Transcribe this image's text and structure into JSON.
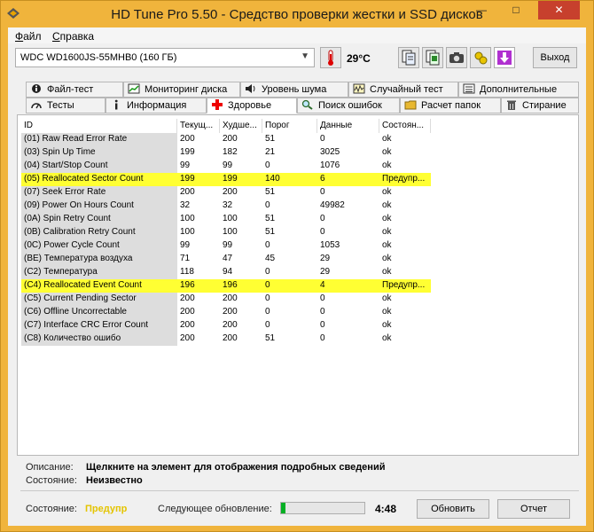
{
  "window": {
    "title": "HD Tune Pro 5.50 - Средство проверки жестки и SSD дисков",
    "controls": {
      "minimize": "—",
      "maximize": "□",
      "close": "✕"
    }
  },
  "menu": [
    {
      "first": "Ф",
      "rest": "айл"
    },
    {
      "first": "С",
      "rest": "правка"
    }
  ],
  "toolbar": {
    "drive": "WDC WD1600JS-55MHB0 (160 ГБ)",
    "temperature": "29°C",
    "exit_label": "Выход"
  },
  "tabs_top": [
    "Файл-тест",
    "Мониторинг диска",
    "Уровень шума",
    "Случайный тест",
    "Дополнительные тесты"
  ],
  "tabs_bottom": [
    "Тесты",
    "Информация",
    "Здоровье",
    "Поиск ошибок",
    "Расчет папок",
    "Стирание"
  ],
  "active_tab": "Здоровье",
  "table": {
    "headers": [
      "ID",
      "Текущ...",
      "Худше...",
      "Порог",
      "Данные",
      "Состоян..."
    ],
    "rows": [
      {
        "id": "(01) Raw Read Error Rate",
        "cur": "200",
        "worst": "200",
        "thr": "51",
        "data": "0",
        "status": "ok",
        "warn": false
      },
      {
        "id": "(03) Spin Up Time",
        "cur": "199",
        "worst": "182",
        "thr": "21",
        "data": "3025",
        "status": "ok",
        "warn": false
      },
      {
        "id": "(04) Start/Stop Count",
        "cur": "99",
        "worst": "99",
        "thr": "0",
        "data": "1076",
        "status": "ok",
        "warn": false
      },
      {
        "id": "(05) Reallocated Sector Count",
        "cur": "199",
        "worst": "199",
        "thr": "140",
        "data": "6",
        "status": "Предупр...",
        "warn": true
      },
      {
        "id": "(07) Seek Error Rate",
        "cur": "200",
        "worst": "200",
        "thr": "51",
        "data": "0",
        "status": "ok",
        "warn": false
      },
      {
        "id": "(09) Power On Hours Count",
        "cur": "32",
        "worst": "32",
        "thr": "0",
        "data": "49982",
        "status": "ok",
        "warn": false
      },
      {
        "id": "(0A) Spin Retry Count",
        "cur": "100",
        "worst": "100",
        "thr": "51",
        "data": "0",
        "status": "ok",
        "warn": false
      },
      {
        "id": "(0B) Calibration Retry Count",
        "cur": "100",
        "worst": "100",
        "thr": "51",
        "data": "0",
        "status": "ok",
        "warn": false
      },
      {
        "id": "(0C) Power Cycle Count",
        "cur": "99",
        "worst": "99",
        "thr": "0",
        "data": "1053",
        "status": "ok",
        "warn": false
      },
      {
        "id": "(BE) Температура воздуха",
        "cur": "71",
        "worst": "47",
        "thr": "45",
        "data": "29",
        "status": "ok",
        "warn": false
      },
      {
        "id": "(C2) Температура",
        "cur": "118",
        "worst": "94",
        "thr": "0",
        "data": "29",
        "status": "ok",
        "warn": false
      },
      {
        "id": "(C4) Reallocated Event Count",
        "cur": "196",
        "worst": "196",
        "thr": "0",
        "data": "4",
        "status": "Предупр...",
        "warn": true
      },
      {
        "id": "(C5) Current Pending Sector",
        "cur": "200",
        "worst": "200",
        "thr": "0",
        "data": "0",
        "status": "ok",
        "warn": false
      },
      {
        "id": "(C6) Offline Uncorrectable",
        "cur": "200",
        "worst": "200",
        "thr": "0",
        "data": "0",
        "status": "ok",
        "warn": false
      },
      {
        "id": "(C7) Interface CRC Error Count",
        "cur": "200",
        "worst": "200",
        "thr": "0",
        "data": "0",
        "status": "ok",
        "warn": false
      },
      {
        "id": "(C8) Количество ошибо",
        "cur": "200",
        "worst": "200",
        "thr": "51",
        "data": "0",
        "status": "ok",
        "warn": false
      }
    ]
  },
  "info": {
    "desc_label": "Описание:",
    "desc_value": "Щелкните на элемент для отображения подробных сведений",
    "state_label": "Состояние:",
    "state_value": "Неизвестно"
  },
  "status": {
    "label": "Состояние:",
    "value": "Предупр",
    "next_update_label": "Следующее обновление:",
    "progress": 0.05,
    "countdown": "4:48",
    "refresh_label": "Обновить",
    "report_label": "Отчет"
  },
  "colors": {
    "frame": "#f0b43c",
    "warn_row": "#ffff33",
    "warn_text": "#e4c400",
    "progress": "#06b025"
  }
}
